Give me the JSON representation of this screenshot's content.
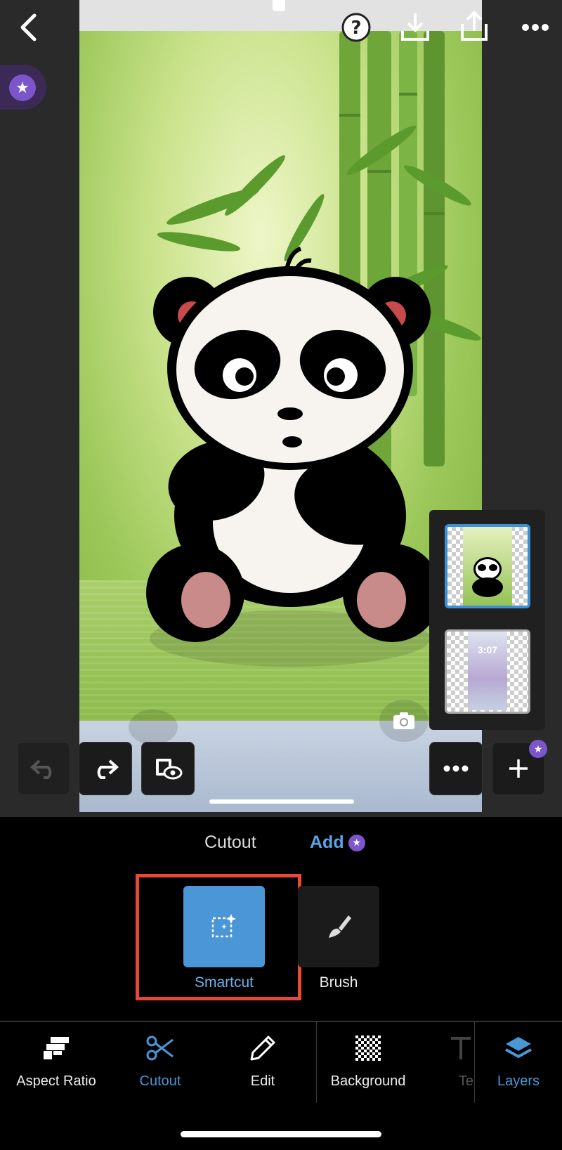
{
  "topbar": {
    "back_icon": "chevron-left-icon",
    "help_icon": "help-circle-icon",
    "download_icon": "download-icon",
    "share_icon": "share-icon",
    "more_icon": "more-horizontal-icon",
    "premium_icon": "star-badge-icon"
  },
  "canvas": {
    "image_description_icon": "panda-bamboo-image"
  },
  "canvas_toolbar": {
    "undo_icon": "undo-icon",
    "redo_icon": "redo-icon",
    "preview_icon": "preview-eye-icon",
    "more_icon": "more-horizontal-icon",
    "add_layer_icon": "plus-icon"
  },
  "layers_panel": {
    "layer2_clock": "3:07"
  },
  "mode_tabs": {
    "cutout": "Cutout",
    "add": "Add"
  },
  "tools": [
    {
      "label": "Smartcut",
      "icon": "smartcut-icon",
      "selected": true
    },
    {
      "label": "Brush",
      "icon": "brush-icon",
      "selected": false
    }
  ],
  "bottom_nav": [
    {
      "label": "Aspect Ratio",
      "icon": "aspect-ratio-icon"
    },
    {
      "label": "Cutout",
      "icon": "scissors-icon",
      "active": true
    },
    {
      "label": "Edit",
      "icon": "pencil-icon"
    },
    {
      "label": "Background",
      "icon": "checker-icon"
    },
    {
      "label": "Te",
      "icon": "text-icon"
    },
    {
      "label": "Layers",
      "icon": "layers-icon",
      "active": true
    }
  ],
  "colors": {
    "accent": "#4a96d6",
    "premium": "#7b55c9",
    "highlight": "#e8473a"
  }
}
